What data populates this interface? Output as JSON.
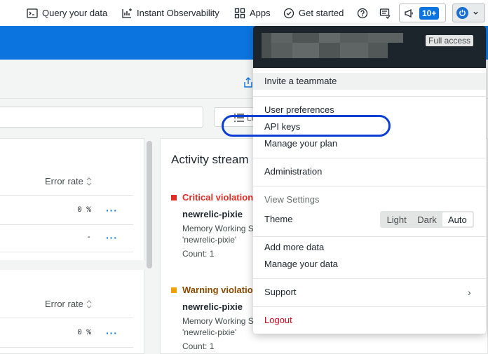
{
  "nav": {
    "query": "Query your data",
    "observability": "Instant Observability",
    "apps": "Apps",
    "get_started": "Get started",
    "notif_count": "10+"
  },
  "toolbar": {
    "list_label": "Li"
  },
  "table": {
    "header": "Error rate",
    "section1_rows": [
      {
        "value": "0 %"
      },
      {
        "value": "-"
      }
    ],
    "section2_rows": [
      {
        "value": "0 %"
      }
    ]
  },
  "activity": {
    "title": "Activity stream",
    "items": [
      {
        "type": "Critical violation c",
        "entity": "newrelic-pixie",
        "line1": "Memory Working S",
        "line2": "'newrelic-pixie'",
        "count": "Count: 1",
        "color": "#df2d24"
      },
      {
        "type": "Warning violation",
        "entity": "newrelic-pixie",
        "line1": "Memory Working S",
        "line2": "'newrelic-pixie'",
        "count": "Count: 1",
        "color": "#f0a000"
      }
    ]
  },
  "menu": {
    "access_badge": "Full access",
    "invite": "Invite a teammate",
    "user_prefs": "User preferences",
    "api_keys": "API keys",
    "manage_plan": "Manage your plan",
    "administration": "Administration",
    "view_settings": "View Settings",
    "theme_label": "Theme",
    "theme_options": {
      "light": "Light",
      "dark": "Dark",
      "auto": "Auto"
    },
    "theme_selected": "Auto",
    "add_data": "Add more data",
    "manage_data": "Manage your data",
    "support": "Support",
    "logout": "Logout"
  },
  "colors": {
    "brand_blue": "#0c74df",
    "highlight": "#0b3fd6",
    "logout_red": "#d0021b"
  }
}
